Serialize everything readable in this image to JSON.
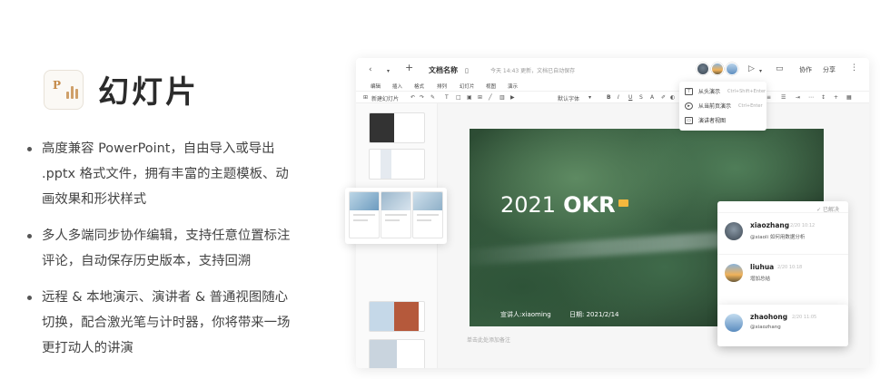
{
  "brand": {
    "title": "幻灯片",
    "icon": "presentation-app-icon",
    "icon_letter": "P"
  },
  "features": [
    "高度兼容 PowerPoint，自由导入或导出 .pptx 格式文件，拥有丰富的主题模板、动画效果和形状样式",
    "多人多端同步协作编辑，支持任意位置标注评论，自动保存历史版本，支持回溯",
    "远程 & 本地演示、演讲者 & 普通视图随心切换，配合激光笔与计时器，你将带来一场更打动人的讲演"
  ],
  "app": {
    "doc_title": "文档名称",
    "save_status": "今天 14:43 更新，文档已自动保存",
    "top_buttons": {
      "collaborate": "协作",
      "share": "分享"
    },
    "menu": [
      "编辑",
      "插入",
      "格式",
      "排列",
      "幻灯片",
      "视图",
      "演示"
    ],
    "toolbar": {
      "new_slide": "新建幻灯片",
      "font": "默认字体"
    },
    "present_menu": [
      {
        "label": "从头演示",
        "shortcut": "Ctrl+Shift+Enter"
      },
      {
        "label": "从当前页演示",
        "shortcut": "Ctrl+Enter"
      },
      {
        "label": "演讲者视图",
        "shortcut": ""
      }
    ],
    "slide": {
      "title_year": "2021",
      "title_bold": "OKR",
      "speaker": "宣讲人:xiaoming",
      "date": "日期: 2021/2/14"
    },
    "stage_note": "单击此处添加备注",
    "comments_header": "✓ 已解决",
    "comments": [
      {
        "name": "xiaozhang",
        "time": "2/20 10:12",
        "text": "@xiaoli 如何用数据分析"
      },
      {
        "name": "liuhua",
        "time": "2/20 10:18",
        "text": "增加总结"
      },
      {
        "name": "zhaohong",
        "time": "2/20 11:05",
        "text": "@xiaozhang"
      }
    ]
  }
}
